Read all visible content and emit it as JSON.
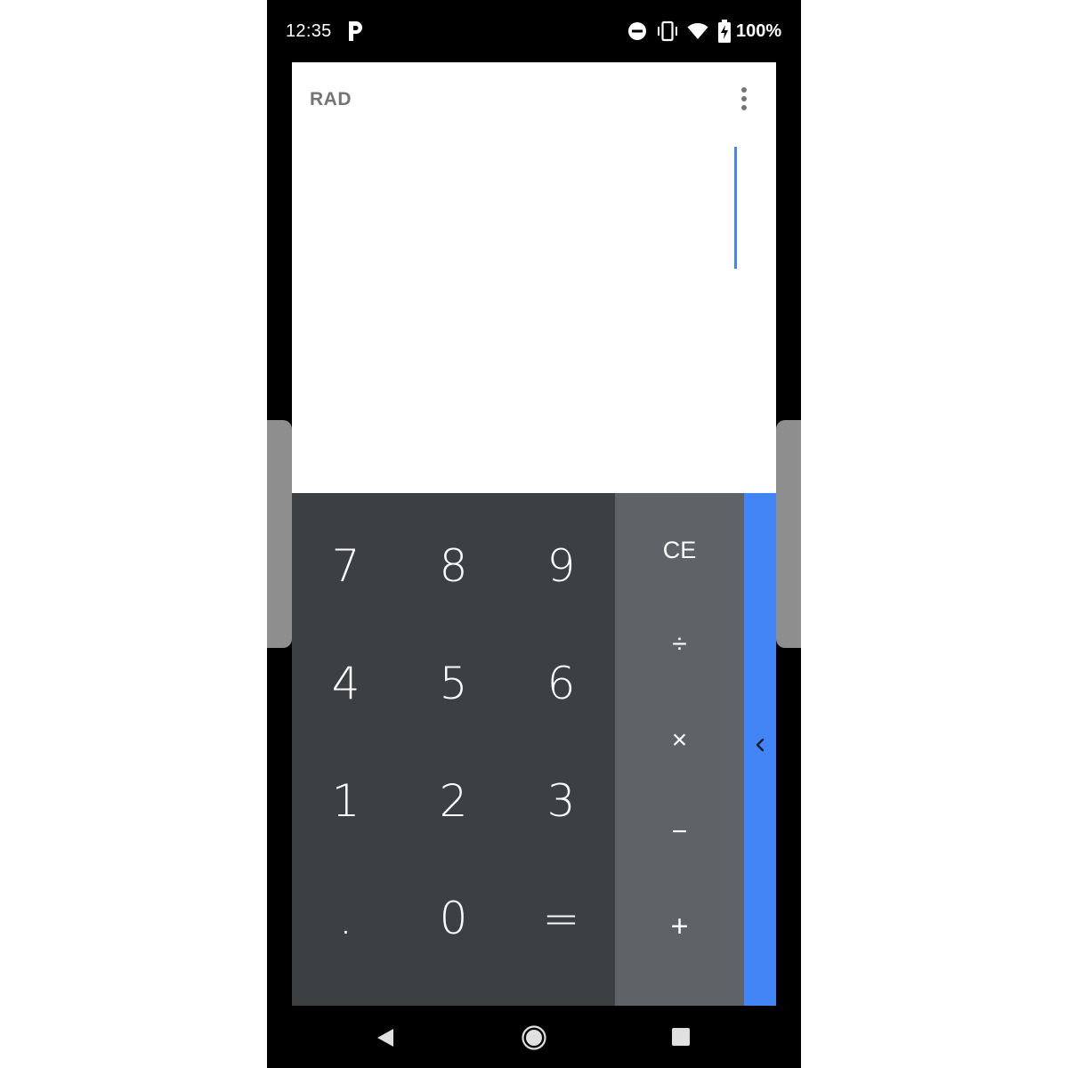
{
  "status_bar": {
    "time": "12:35",
    "notification_icon": "p-icon",
    "icons": [
      "do-not-disturb-icon",
      "vibrate-icon",
      "wifi-icon",
      "battery-charging-icon"
    ],
    "battery_percent": "100%"
  },
  "display": {
    "angle_mode": "RAD",
    "overflow_icon": "more-vert-icon",
    "expression": "",
    "cursor_color": "#4285f4"
  },
  "keypad": {
    "digits": [
      [
        "7",
        "8",
        "9"
      ],
      [
        "4",
        "5",
        "6"
      ],
      [
        "1",
        "2",
        "3"
      ],
      [
        ".",
        "0",
        "="
      ]
    ],
    "operators": [
      "CE",
      "÷",
      "×",
      "−",
      "+"
    ]
  },
  "advanced_panel": {
    "icon": "chevron-left-icon",
    "color": "#4285f4"
  },
  "nav_bar": {
    "icons": [
      "back-icon",
      "home-icon",
      "recents-icon"
    ]
  },
  "colors": {
    "numpad_bg": "#3c4043",
    "operator_bg": "#5f6368",
    "accent": "#4285f4"
  }
}
